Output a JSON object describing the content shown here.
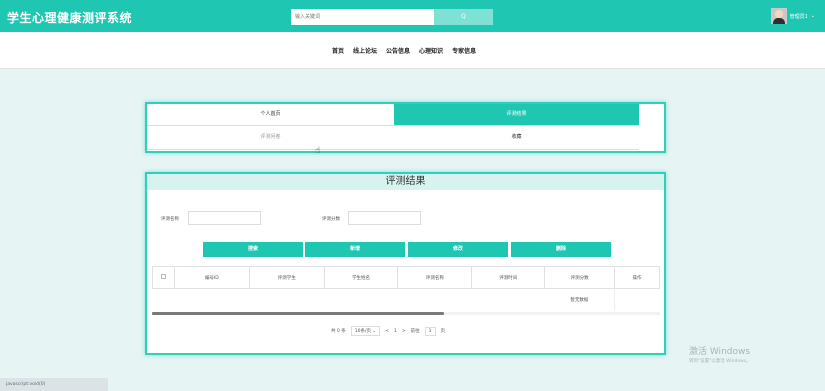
{
  "header": {
    "site_title": "学生心理健康测评系统",
    "search_placeholder": "输入关键词",
    "search_button": "Q",
    "user_name": "管理员1",
    "user_caret": "⌄"
  },
  "nav": {
    "items": [
      "首页",
      "线上论坛",
      "公告信息",
      "心理知识",
      "专家信息"
    ]
  },
  "tabs": {
    "row1": [
      "个人首页",
      "评测结果"
    ],
    "row2": [
      "评测问卷",
      "收藏"
    ],
    "active": "评测结果"
  },
  "panel": {
    "title": "评测结果",
    "filters": [
      {
        "label": "评测名称",
        "value": ""
      },
      {
        "label": "评测分数",
        "value": ""
      }
    ],
    "buttons": [
      "搜索",
      "新增",
      "修改",
      "删除"
    ]
  },
  "table": {
    "columns": [
      "",
      "编号ID",
      "评测学生",
      "学生姓名",
      "评测名称",
      "评测时间",
      "评测分数",
      "操作"
    ],
    "empty_text": "暂无数据"
  },
  "pager": {
    "total": "共 0 条",
    "page_size": "10条/页",
    "prev": "<",
    "current": "1",
    "next": ">",
    "goto_label": "前往",
    "goto_value": "1",
    "page_suffix": "页"
  },
  "watermark": {
    "line1": "激活 Windows",
    "line2": "转到\"设置\"以激活 Windows。"
  },
  "status_bar": {
    "text": "javascript:void(0)"
  },
  "colors": {
    "accent": "#1fc6b2",
    "accent_light": "#d6f3ef",
    "background": "#e6f4f3"
  }
}
